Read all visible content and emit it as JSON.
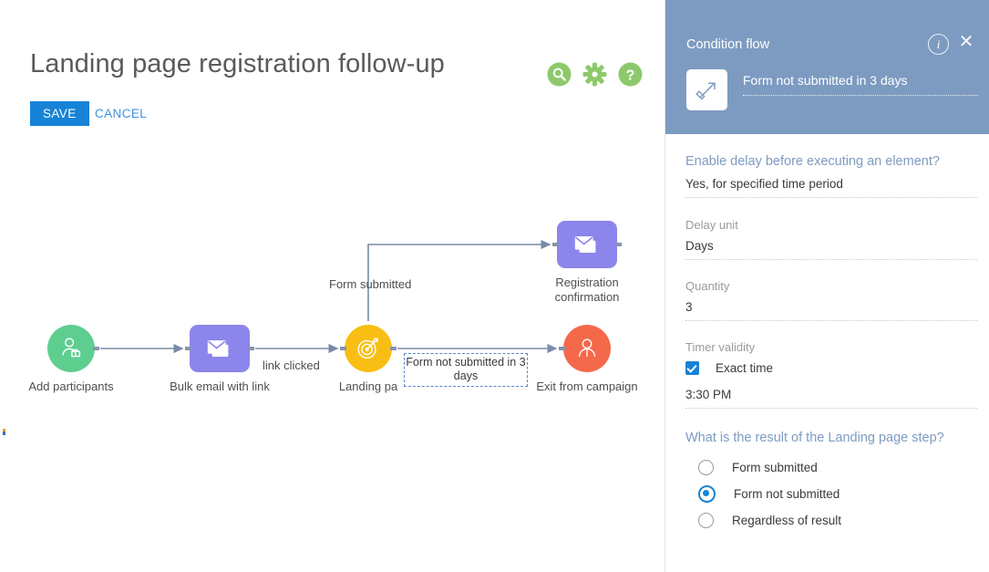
{
  "header": {
    "title": "Landing page registration follow-up",
    "save_label": "SAVE",
    "cancel_label": "CANCEL",
    "tools": [
      {
        "name": "search-icon",
        "tooltip": "Search"
      },
      {
        "name": "gear-icon",
        "tooltip": "Settings"
      },
      {
        "name": "help-icon",
        "tooltip": "Help"
      }
    ],
    "accent_color": "#1683D8",
    "tool_color": "#8DC96A"
  },
  "diagram": {
    "nodes": [
      {
        "id": "add-participants",
        "label": "Add participants",
        "icon": "user-card-icon",
        "shape": "circle",
        "color": "#5ECE8F"
      },
      {
        "id": "bulk-email-with-link",
        "label": "Bulk email with link",
        "icon": "envelope-icon",
        "shape": "square",
        "color": "#8C86EC"
      },
      {
        "id": "landing-page",
        "label": "Landing pa",
        "icon": "target-arrow-icon",
        "shape": "circle",
        "color": "#F9BE13"
      },
      {
        "id": "registration-confirmation",
        "label": "Registration confirmation",
        "icon": "envelope-icon",
        "shape": "square",
        "color": "#8C86EC"
      },
      {
        "id": "exit-from-campaign",
        "label": "Exit from campaign",
        "icon": "user-icon",
        "shape": "circle",
        "color": "#F4694A"
      }
    ],
    "edge_labels": {
      "link_clicked": "link clicked",
      "form_submitted": "Form submitted",
      "condition_box": "Form not submitted in 3 days"
    },
    "edge_color": "#7A8BA8"
  },
  "panel": {
    "title": "Condition flow",
    "header_color": "#7D9BC1",
    "info_icon": "info-icon",
    "close_icon": "close-icon",
    "step_icon": "diagonal-arrow-icon",
    "step_name": "Form not submitted in 3 days",
    "fields": [
      {
        "label": "Enable delay before executing an element?",
        "value": "Yes, for specified time period",
        "accent": true
      },
      {
        "label": "Delay unit",
        "value": "Days",
        "accent": false
      },
      {
        "label": "Quantity",
        "value": "3",
        "accent": false
      }
    ],
    "timer": {
      "label": "Timer validity",
      "checkbox_label": "Exact time",
      "checkbox_checked": true,
      "time_value": "3:30 PM"
    },
    "result": {
      "question": "What is the result of the Landing page step?",
      "options": [
        {
          "label": "Form submitted",
          "selected": false
        },
        {
          "label": "Form not submitted",
          "selected": true
        },
        {
          "label": "Regardless of result",
          "selected": false
        }
      ]
    }
  }
}
